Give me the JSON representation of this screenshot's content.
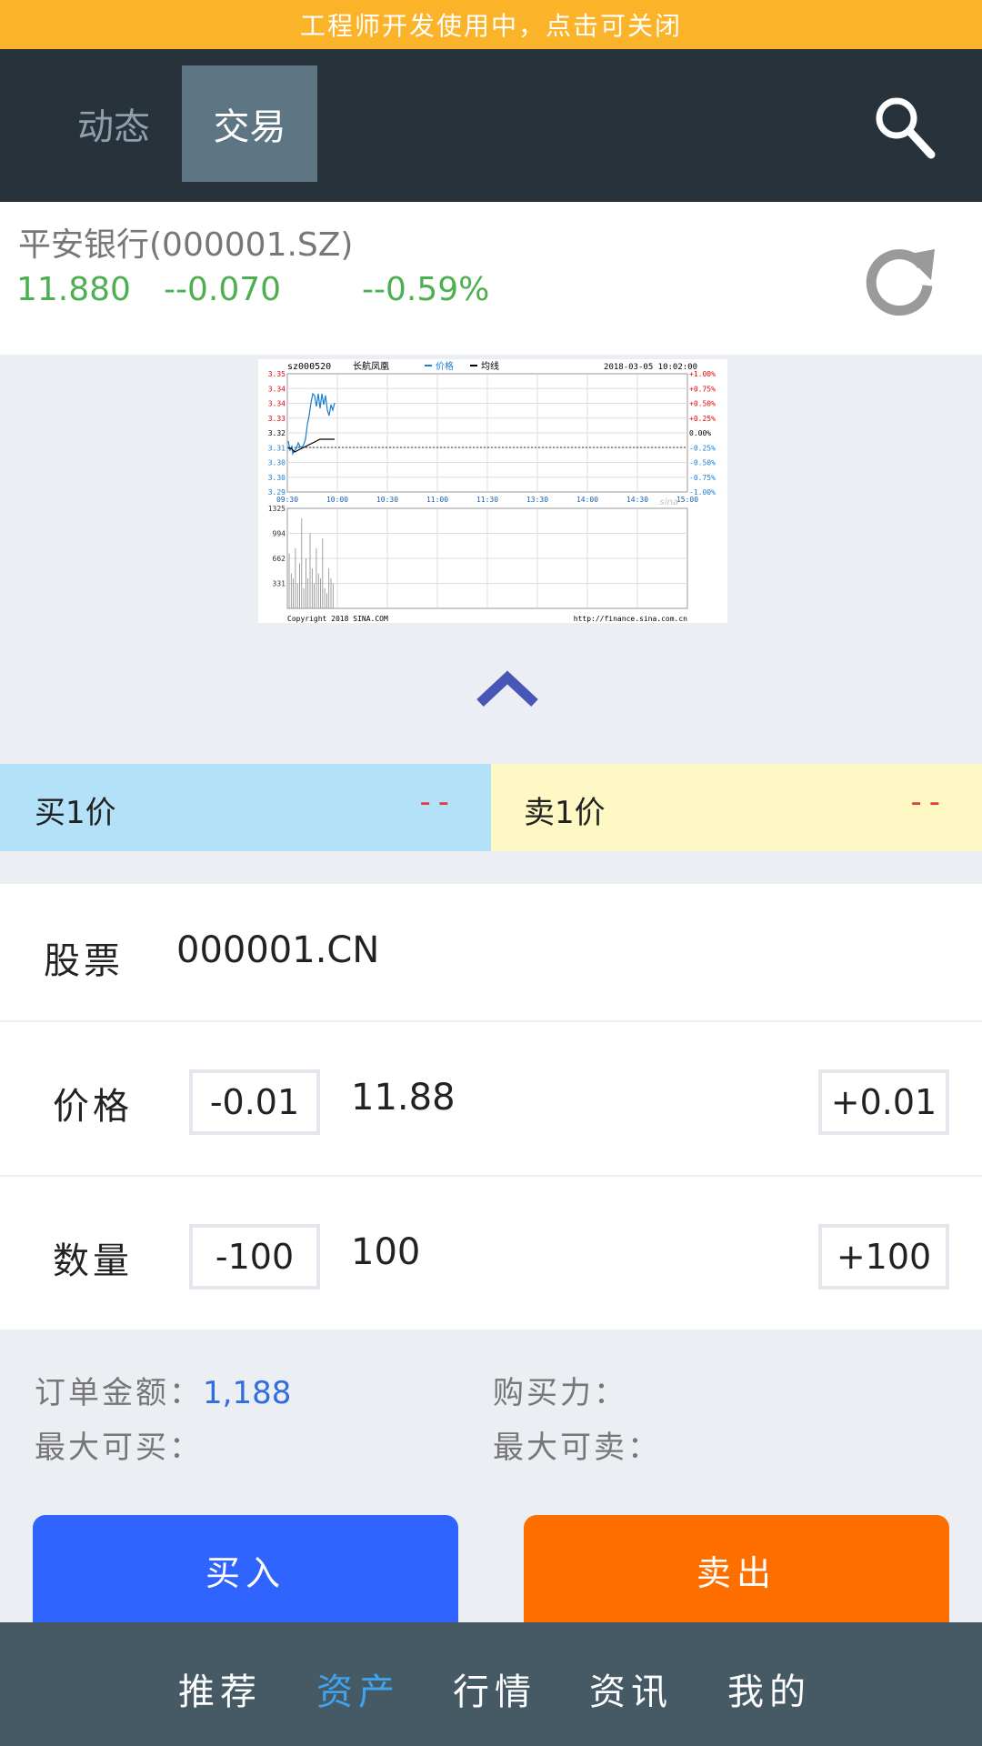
{
  "dev_banner": "工程师开发使用中，点击可关闭",
  "header": {
    "tabs": [
      {
        "label": "动态",
        "active": false
      },
      {
        "label": "交易",
        "active": true
      }
    ],
    "search_icon": "search-icon"
  },
  "quote": {
    "name": "平安银行(000001.SZ)",
    "price": "11.880",
    "change": "--0.070",
    "change_pct": "--0.59%",
    "price_color": "#4caf50",
    "refresh_icon": "refresh-icon"
  },
  "chart": {
    "code": "sz000520",
    "name": "长航凤凰",
    "legend_price": "价格",
    "legend_avg": "均线",
    "datetime": "2018-03-05 10:02:00",
    "y_left": [
      "3.35",
      "3.34",
      "3.34",
      "3.33",
      "3.32",
      "3.31",
      "3.30",
      "3.30",
      "3.29"
    ],
    "y_right": [
      "+1.00%",
      "+0.75%",
      "+0.50%",
      "+0.25%",
      "0.00%",
      "-0.25%",
      "-0.50%",
      "-0.75%",
      "-1.00%"
    ],
    "x_labels": [
      "09:30",
      "10:00",
      "10:30",
      "11:00",
      "11:30",
      "13:30",
      "14:00",
      "14:30",
      "15:00"
    ],
    "volume_labels": [
      "1325",
      "994",
      "662",
      "331"
    ],
    "copyright": "Copyright 2018 SINA.COM",
    "source_url": "http://finance.sina.com.cn",
    "watermark": "sina",
    "collapse_icon": "chevron-up-icon"
  },
  "order_book": {
    "bid_label": "买1价",
    "bid_value": "--",
    "ask_label": "卖1价",
    "ask_value": "--"
  },
  "form": {
    "stock_label": "股票",
    "stock_code": "000001.CN",
    "price_label": "价格",
    "price_minus": "-0.01",
    "price_value": "11.88",
    "price_plus": "+0.01",
    "qty_label": "数量",
    "qty_minus": "-100",
    "qty_value": "100",
    "qty_plus": "+100"
  },
  "summary": {
    "order_amount_label": "订单金额：",
    "order_amount_value": "1,188",
    "buying_power_label": "购买力：",
    "max_buy_label": "最大可买：",
    "max_sell_label": "最大可卖："
  },
  "actions": {
    "buy": "买入",
    "sell": "卖出",
    "buy_color": "#2f64ff",
    "sell_color": "#ff6f00"
  },
  "bottom_nav": [
    {
      "label": "推荐",
      "active": false
    },
    {
      "label": "资产",
      "active": true
    },
    {
      "label": "行情",
      "active": false
    },
    {
      "label": "资讯",
      "active": false
    },
    {
      "label": "我的",
      "active": false
    }
  ]
}
